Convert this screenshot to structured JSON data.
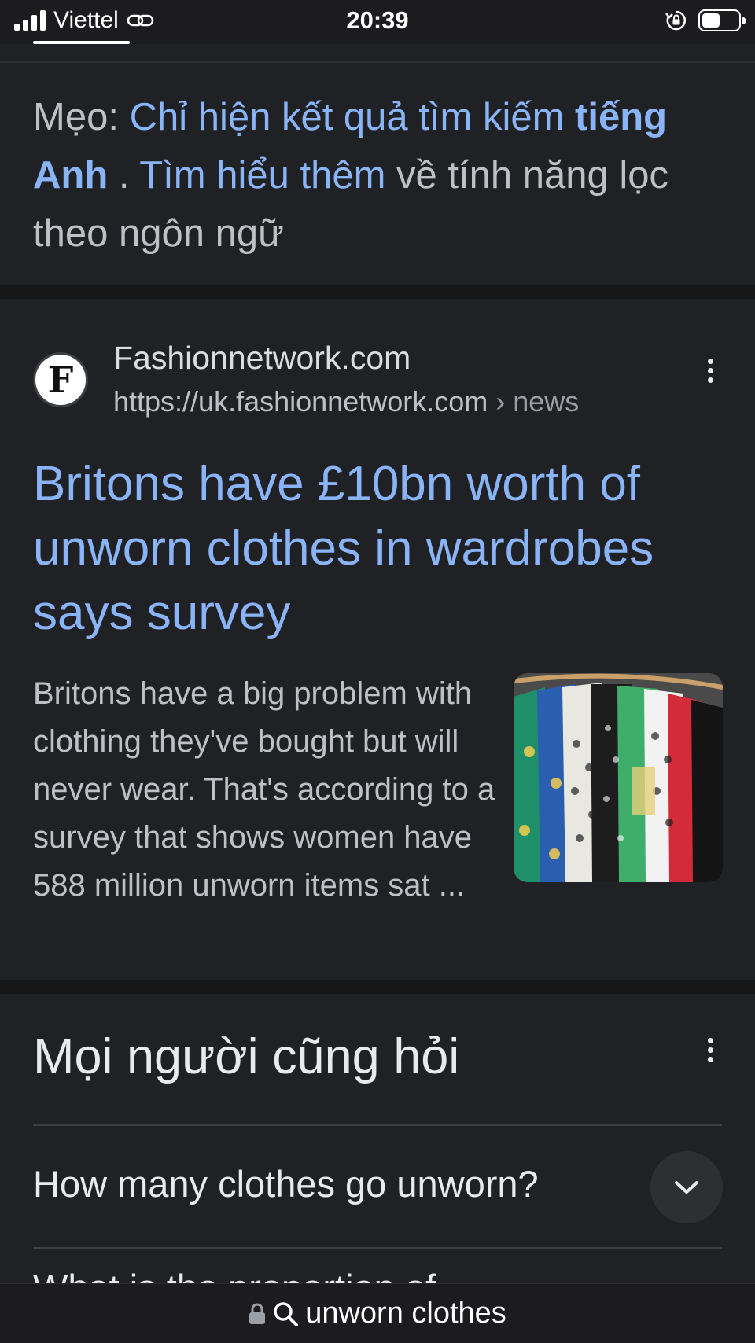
{
  "status_bar": {
    "carrier": "Viettel",
    "time": "20:39",
    "battery_level": 0.5
  },
  "tip": {
    "prefix": "Mẹo: ",
    "link1": "Chỉ hiện kết quả tìm kiếm",
    "language": "tiếng Anh",
    "separator": " . ",
    "link2": "Tìm hiểu thêm",
    "suffix": " về tính năng lọc theo ngôn ngữ"
  },
  "result": {
    "favicon_letter": "F",
    "site_name": "Fashionnetwork.com",
    "url": "https://uk.fashionnetwork.com",
    "breadcrumb": " › news",
    "title": "Britons have £10bn worth of unworn clothes in wardrobes says survey",
    "snippet": "Britons have a big problem with clothing they've bought but will never wear. That's according to a survey that shows women have 588 million unworn items sat ..."
  },
  "people_also_ask": {
    "heading": "Mọi người cũng hỏi",
    "questions": [
      "How many clothes go unworn?",
      "What is the proportion of"
    ]
  },
  "address_bar": {
    "query": "unworn clothes"
  },
  "icons": {
    "signal": "signal-bars-icon",
    "link": "link-icon",
    "rotation_lock": "rotation-lock-icon",
    "battery": "battery-icon",
    "more": "more-vert-icon",
    "chevron": "chevron-down-icon",
    "lock": "lock-icon",
    "search": "search-icon"
  },
  "colors": {
    "background": "#202124",
    "link": "#8ab4f8",
    "text": "#bdc1c6",
    "heading": "#e8eaed"
  }
}
